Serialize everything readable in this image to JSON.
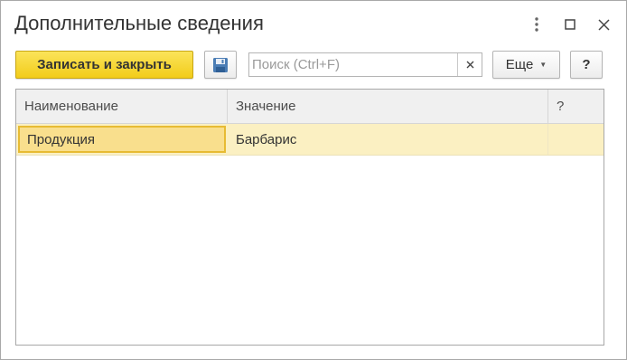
{
  "window": {
    "title": "Дополнительные сведения",
    "more_icon": "vertical-dots-icon",
    "maximize_icon": "maximize-icon",
    "close_icon": "close-icon"
  },
  "toolbar": {
    "save_close_label": "Записать и закрыть",
    "save_icon": "floppy-disk-icon",
    "search_placeholder": "Поиск (Ctrl+F)",
    "search_value": "",
    "clear_label": "×",
    "more_label": "Еще",
    "help_label": "?"
  },
  "table": {
    "columns": [
      "Наименование",
      "Значение",
      "?"
    ],
    "rows": [
      {
        "name": "Продукция",
        "value": "Барбарис",
        "q": ""
      }
    ]
  },
  "colors": {
    "primary_button": "#f2cc1a",
    "selected_row": "#fbf0c2",
    "selected_cell_border": "#e7bb33"
  }
}
